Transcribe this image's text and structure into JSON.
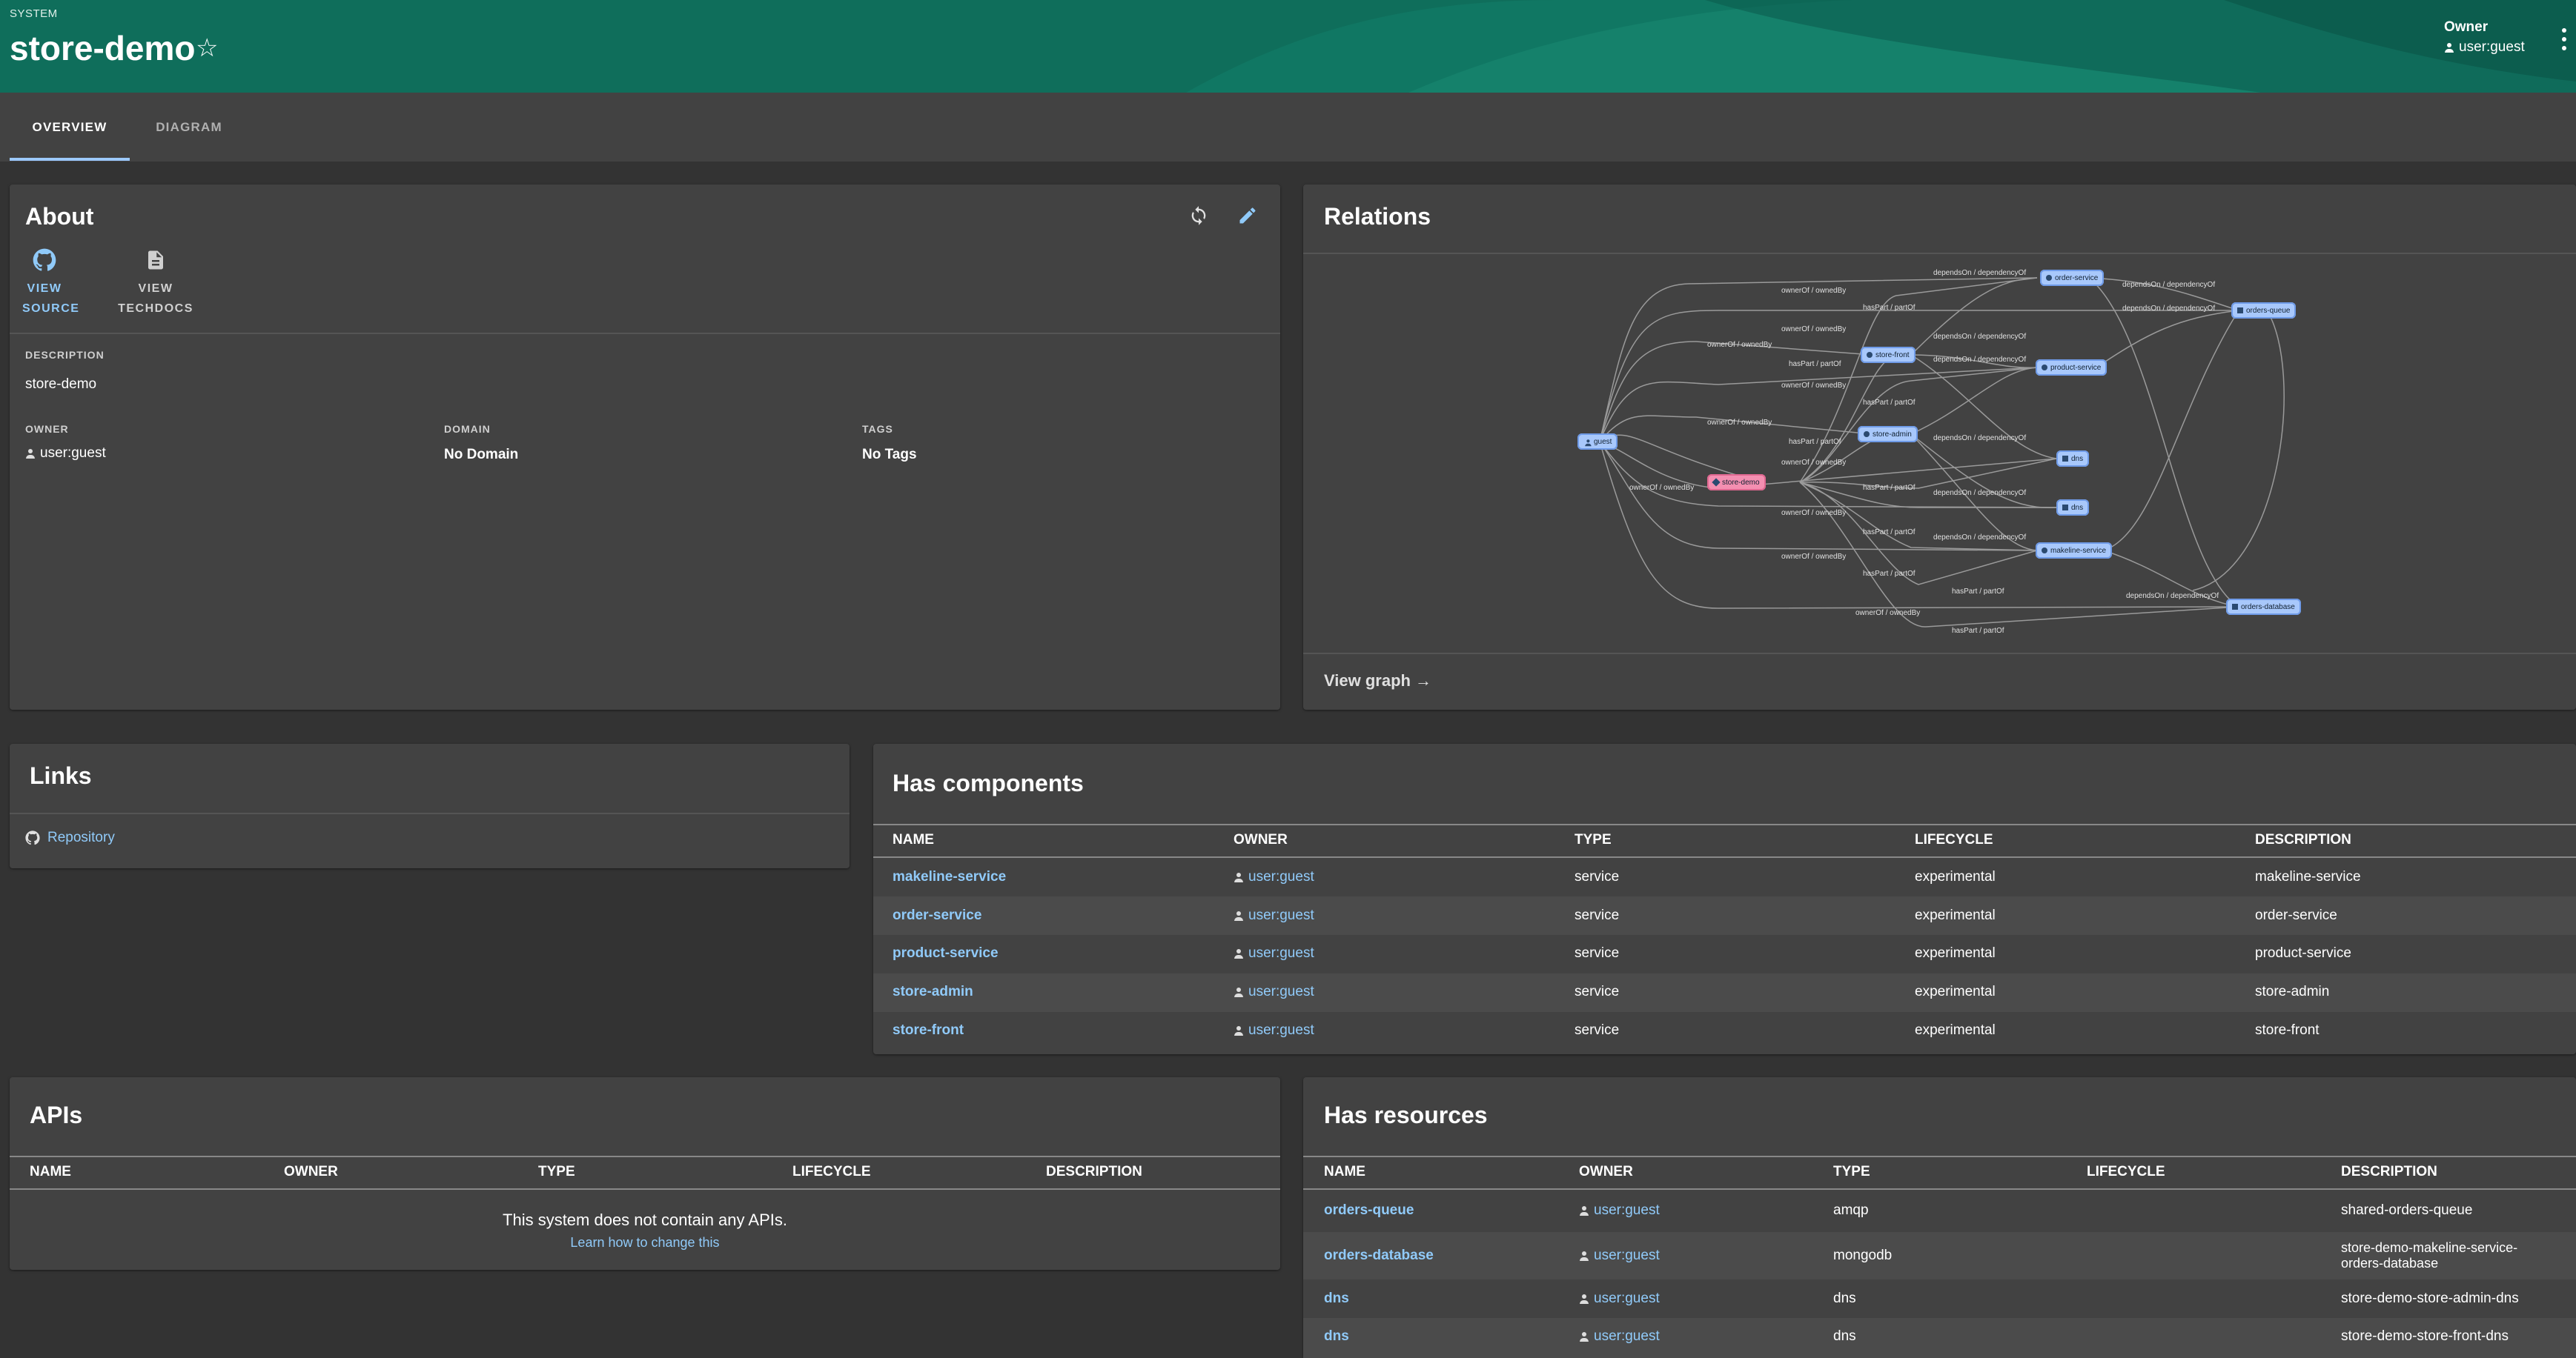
{
  "header": {
    "kind": "SYSTEM",
    "title": "store-demo",
    "owner_label": "Owner",
    "owner_value": "user:guest"
  },
  "tabs": [
    {
      "label": "OVERVIEW",
      "active": true
    },
    {
      "label": "DIAGRAM",
      "active": false
    }
  ],
  "about": {
    "title": "About",
    "view_source": [
      "VIEW",
      "SOURCE"
    ],
    "view_techdocs": [
      "VIEW",
      "TECHDOCS"
    ],
    "description_label": "DESCRIPTION",
    "description": "store-demo",
    "owner_label": "OWNER",
    "owner": "user:guest",
    "domain_label": "DOMAIN",
    "domain": "No Domain",
    "tags_label": "TAGS",
    "tags": "No Tags"
  },
  "relations": {
    "title": "Relations",
    "view_graph": "View graph",
    "nodes": {
      "guest": "guest",
      "store_demo": "store-demo",
      "store_front": "store-front",
      "store_admin": "store-admin",
      "order_service": "order-service",
      "product_service": "product-service",
      "makeline_service": "makeline-service",
      "dns1": "dns",
      "dns2": "dns",
      "orders_queue": "orders-queue",
      "orders_database": "orders-database"
    },
    "edge_labels": {
      "owner_of": "ownerOf / ownedBy",
      "has_part": "hasPart / partOf",
      "depends_on": "dependsOn / dependencyOf"
    }
  },
  "links": {
    "title": "Links",
    "repository": "Repository"
  },
  "components": {
    "title": "Has components",
    "headers": [
      "NAME",
      "OWNER",
      "TYPE",
      "LIFECYCLE",
      "DESCRIPTION"
    ],
    "rows": [
      {
        "name": "makeline-service",
        "owner": "user:guest",
        "type": "service",
        "lifecycle": "experimental",
        "description": "makeline-service"
      },
      {
        "name": "order-service",
        "owner": "user:guest",
        "type": "service",
        "lifecycle": "experimental",
        "description": "order-service"
      },
      {
        "name": "product-service",
        "owner": "user:guest",
        "type": "service",
        "lifecycle": "experimental",
        "description": "product-service"
      },
      {
        "name": "store-admin",
        "owner": "user:guest",
        "type": "service",
        "lifecycle": "experimental",
        "description": "store-admin"
      },
      {
        "name": "store-front",
        "owner": "user:guest",
        "type": "service",
        "lifecycle": "experimental",
        "description": "store-front"
      }
    ]
  },
  "apis": {
    "title": "APIs",
    "headers": [
      "NAME",
      "OWNER",
      "TYPE",
      "LIFECYCLE",
      "DESCRIPTION"
    ],
    "empty_message": "This system does not contain any APIs.",
    "learn_link": "Learn how to change this"
  },
  "resources": {
    "title": "Has resources",
    "headers": [
      "NAME",
      "OWNER",
      "TYPE",
      "LIFECYCLE",
      "DESCRIPTION"
    ],
    "rows": [
      {
        "name": "orders-queue",
        "owner": "user:guest",
        "type": "amqp",
        "lifecycle": "",
        "description": "shared-orders-queue"
      },
      {
        "name": "orders-database",
        "owner": "user:guest",
        "type": "mongodb",
        "lifecycle": "",
        "description": "store-demo-makeline-service-orders-database"
      },
      {
        "name": "dns",
        "owner": "user:guest",
        "type": "dns",
        "lifecycle": "",
        "description": "store-demo-store-admin-dns"
      },
      {
        "name": "dns",
        "owner": "user:guest",
        "type": "dns",
        "lifecycle": "",
        "description": "store-demo-store-front-dns"
      }
    ]
  },
  "colors": {
    "header": "#0f6e5b",
    "background": "#333333",
    "card": "#424242",
    "link": "#90caf9",
    "node": "#a8c8fb",
    "node_system": "#f48fb1"
  }
}
